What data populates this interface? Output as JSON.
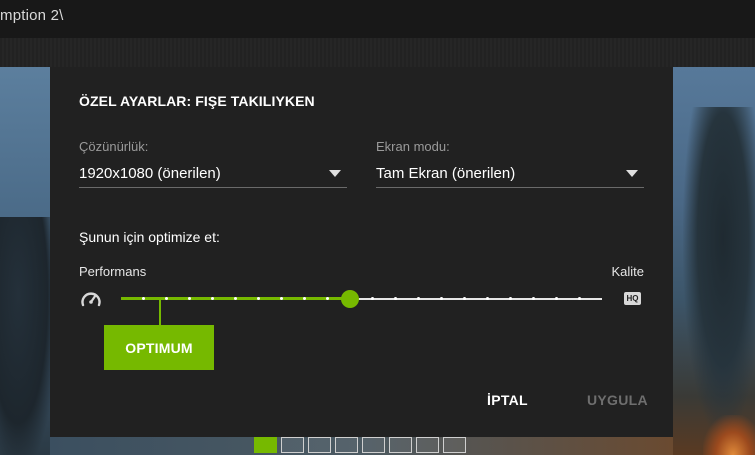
{
  "window": {
    "title": "mption 2\\"
  },
  "dialog": {
    "title": "ÖZEL AYARLAR: FIŞE TAKILIYKEN",
    "resolution": {
      "label": "Çözünürlük:",
      "value": "1920x1080 (önerilen)"
    },
    "display_mode": {
      "label": "Ekran modu:",
      "value": "Tam Ekran (önerilen)"
    },
    "optimize_label": "Şunun için optimize et:",
    "slider": {
      "left_label": "Performans",
      "right_label": "Kalite",
      "right_icon_text": "HQ",
      "steps": 22,
      "value_step": 10,
      "tooltip": "OPTIMUM"
    },
    "cancel_label": "İPTAL",
    "apply_label": "UYGULA"
  },
  "pager": {
    "count": 8,
    "active": 0
  },
  "icons": {
    "gauge": "speedometer-icon",
    "hq": "hq-icon",
    "dropdown": "chevron-down-icon"
  },
  "colors": {
    "accent": "#76b900",
    "dialog_bg": "#212121",
    "disabled_text": "#6e6e6e"
  }
}
